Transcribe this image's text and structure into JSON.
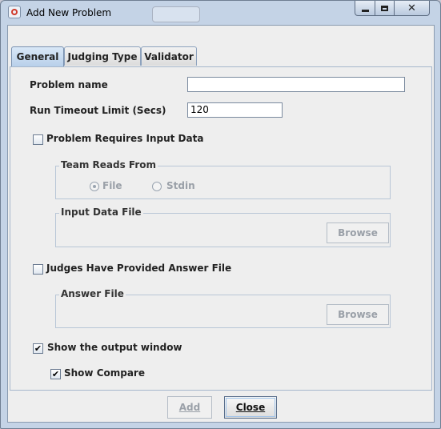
{
  "window": {
    "title": "Add New Problem"
  },
  "tabs": [
    {
      "label": "General"
    },
    {
      "label": "Judging Type"
    },
    {
      "label": "Validator"
    }
  ],
  "general": {
    "problem_name": {
      "label": "Problem name",
      "value": ""
    },
    "run_timeout": {
      "label": "Run Timeout Limit (Secs)",
      "value": "120"
    },
    "requires_input": {
      "label": "Problem Requires Input Data",
      "checked": false
    },
    "team_reads_from": {
      "title": "Team Reads From",
      "options": [
        {
          "label": "File",
          "selected": true
        },
        {
          "label": "Stdin",
          "selected": false
        }
      ]
    },
    "input_data_file": {
      "title": "Input Data File",
      "browse_label": "Browse"
    },
    "answer_provided": {
      "label": "Judges Have Provided Answer File",
      "checked": false
    },
    "answer_file": {
      "title": "Answer File",
      "browse_label": "Browse"
    },
    "show_output": {
      "label": "Show the output window",
      "checked": true,
      "mark": "✔"
    },
    "show_compare": {
      "label": "Show Compare",
      "checked": true,
      "mark": "✔"
    }
  },
  "footer": {
    "add_label": "Add",
    "close_label": "Close"
  }
}
